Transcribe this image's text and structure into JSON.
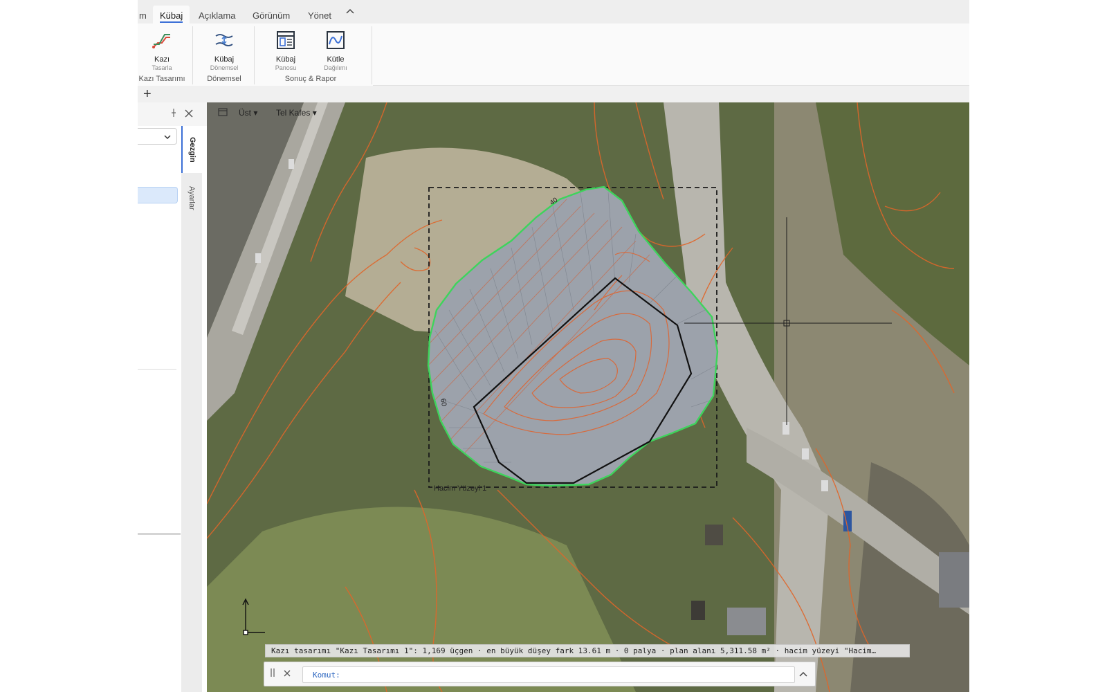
{
  "ribbon": {
    "tabs": [
      {
        "label": "m",
        "active": false
      },
      {
        "label": "Kübaj",
        "active": true
      },
      {
        "label": "Açıklama",
        "active": false
      },
      {
        "label": "Görünüm",
        "active": false
      },
      {
        "label": "Yönet",
        "active": false
      }
    ],
    "groups": [
      {
        "label": "Kazı Tasarımı",
        "buttons": [
          {
            "line1": "Kazı",
            "line2": "Tasarla",
            "icon": "excavation-design-icon"
          }
        ]
      },
      {
        "label": "Dönemsel",
        "buttons": [
          {
            "line1": "Kübaj",
            "line2": "Dönemsel",
            "icon": "periodic-volume-icon"
          }
        ]
      },
      {
        "label": "Sonuç & Rapor",
        "buttons": [
          {
            "line1": "Kübaj",
            "line2": "Panosu",
            "icon": "volume-dashboard-icon"
          },
          {
            "line1": "Kütle",
            "line2": "Dağılımı",
            "icon": "mass-distribution-icon"
          }
        ]
      }
    ]
  },
  "left_panel": {
    "side_tabs": [
      "Gezgin",
      "Ayarlar"
    ],
    "active_tab": "Gezgin"
  },
  "viewport": {
    "view_label": "Üst",
    "style_label": "Tel Kafes",
    "contour_labels": [
      "40",
      "60"
    ],
    "surface_label": "Hacim Yüzeyi 1"
  },
  "status": {
    "message": "Kazı tasarımı \"Kazı Tasarımı 1\": 1,169 üçgen · en büyük düşey fark 13.61 m · 0 palya · plan alanı 5,311.58 m² · hacim yüzeyi \"Hacim…"
  },
  "command": {
    "prompt": "Komut:"
  },
  "colors": {
    "accent": "#3b6fd6",
    "boundary_green": "#3ed45c",
    "contour_orange": "#e0662a",
    "design_grey": "#9ca2ab"
  }
}
